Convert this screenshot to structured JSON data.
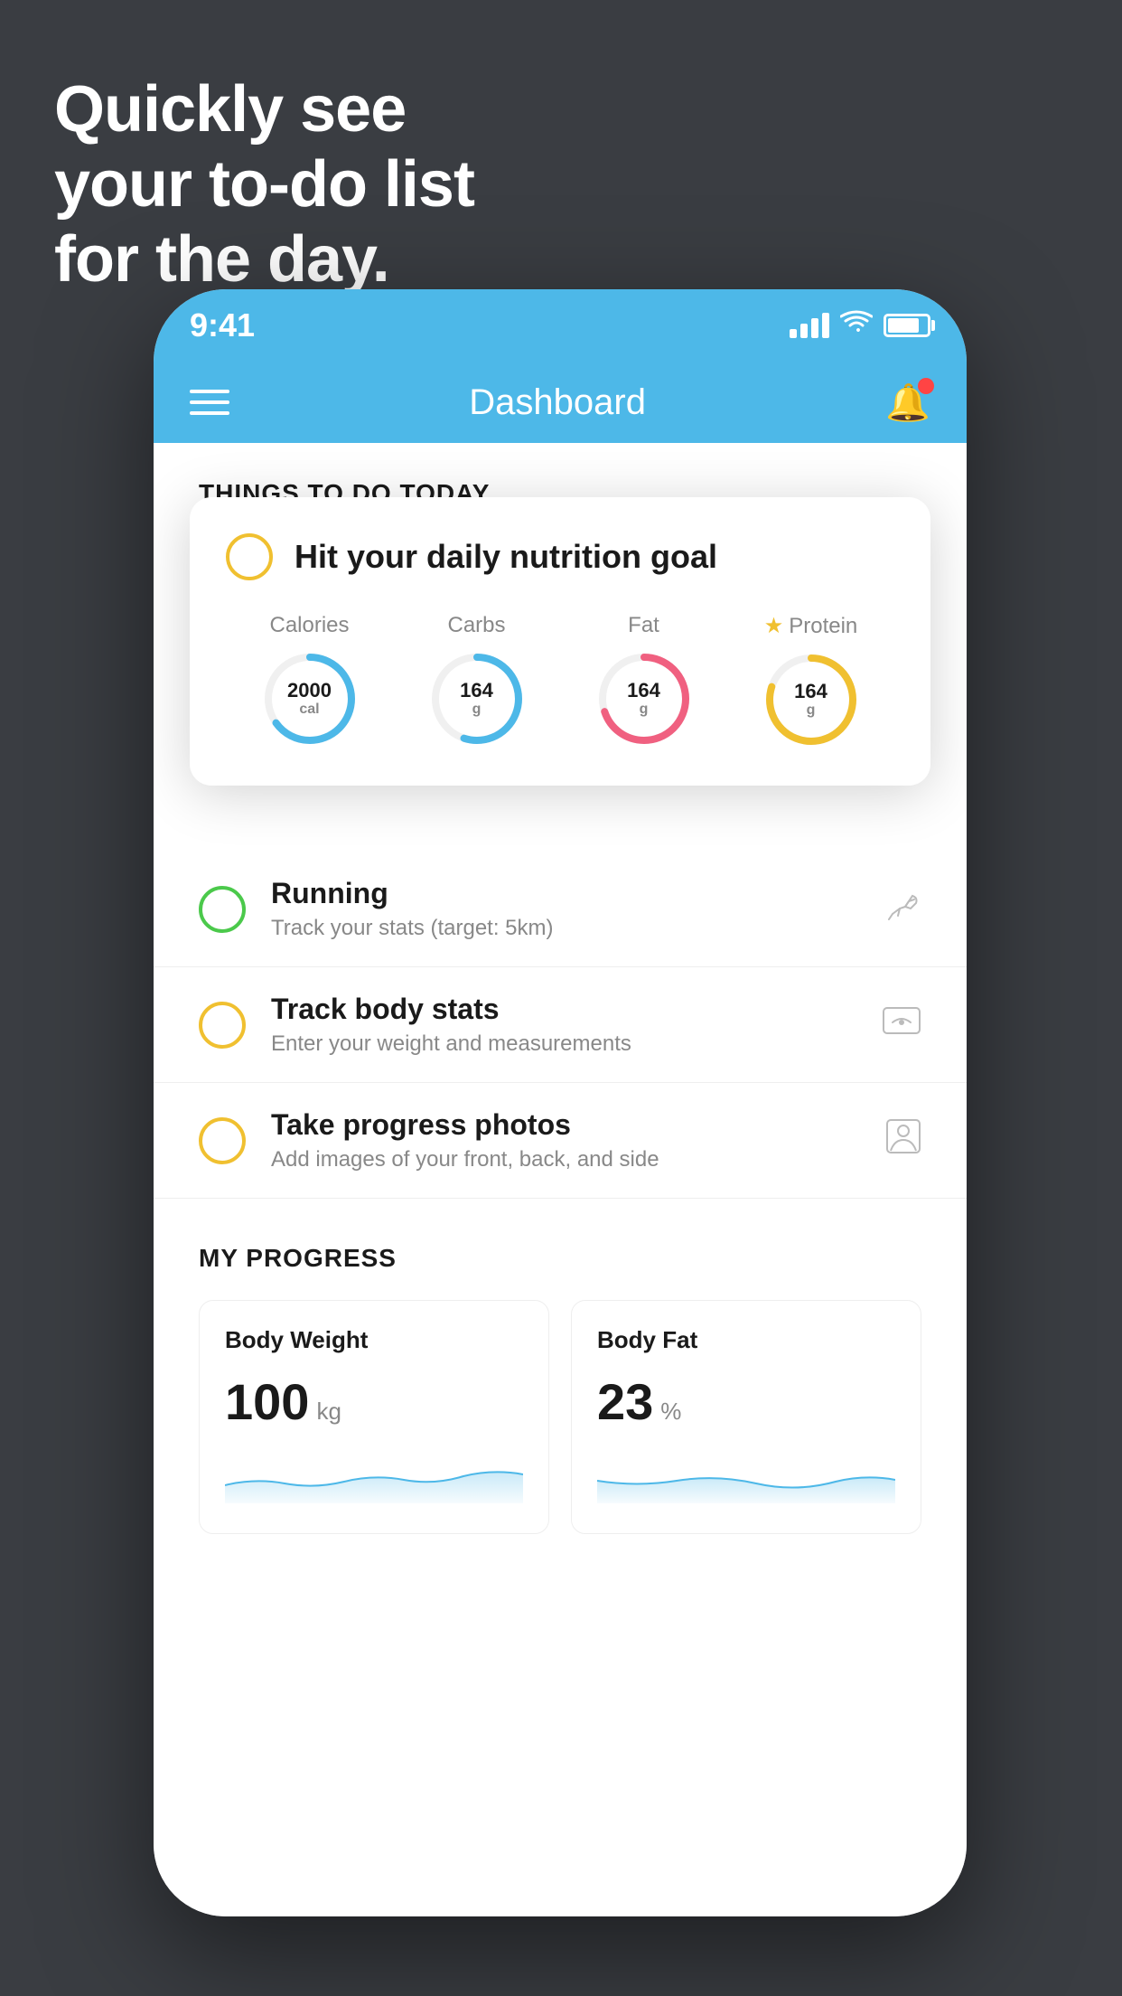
{
  "headline": {
    "line1": "Quickly see",
    "line2": "your to-do list",
    "line3": "for the day."
  },
  "status_bar": {
    "time": "9:41",
    "signal_bars": [
      10,
      16,
      22,
      28
    ],
    "wifi": "wifi",
    "battery": "battery"
  },
  "nav": {
    "title": "Dashboard"
  },
  "things_section": {
    "header": "THINGS TO DO TODAY"
  },
  "floating_card": {
    "title": "Hit your daily nutrition goal",
    "nutrition": [
      {
        "label": "Calories",
        "value": "2000",
        "unit": "cal",
        "color": "#4db8e8",
        "progress": 0.65
      },
      {
        "label": "Carbs",
        "value": "164",
        "unit": "g",
        "color": "#4db8e8",
        "progress": 0.55
      },
      {
        "label": "Fat",
        "value": "164",
        "unit": "g",
        "color": "#f06080",
        "progress": 0.7
      },
      {
        "label": "Protein",
        "value": "164",
        "unit": "g",
        "color": "#f0c030",
        "progress": 0.8,
        "starred": true
      }
    ]
  },
  "todo_items": [
    {
      "id": "running",
      "checkbox_color": "green",
      "title": "Running",
      "subtitle": "Track your stats (target: 5km)",
      "icon": "👟"
    },
    {
      "id": "track-body",
      "checkbox_color": "yellow",
      "title": "Track body stats",
      "subtitle": "Enter your weight and measurements",
      "icon": "⚖"
    },
    {
      "id": "progress-photos",
      "checkbox_color": "yellow",
      "title": "Take progress photos",
      "subtitle": "Add images of your front, back, and side",
      "icon": "🪪"
    }
  ],
  "progress_section": {
    "header": "MY PROGRESS",
    "cards": [
      {
        "id": "body-weight",
        "title": "Body Weight",
        "value": "100",
        "unit": "kg"
      },
      {
        "id": "body-fat",
        "title": "Body Fat",
        "value": "23",
        "unit": "%"
      }
    ]
  }
}
